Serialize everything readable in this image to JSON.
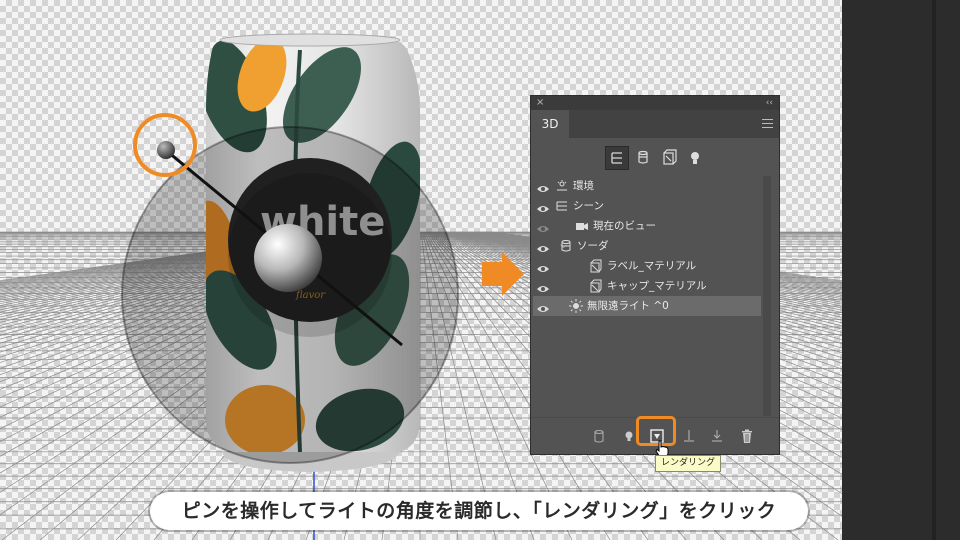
{
  "panel": {
    "tab_label": "3D",
    "close_glyph": "×",
    "collapse_glyph": "‹‹",
    "filter_icons": [
      "scene-filter-icon",
      "mesh-filter-icon",
      "material-filter-icon",
      "light-filter-icon"
    ],
    "layers": [
      {
        "label": "環境",
        "icon": "environment-icon",
        "visible": true,
        "selected": false
      },
      {
        "label": "シーン",
        "icon": "scene-icon",
        "visible": true,
        "selected": false
      },
      {
        "label": "現在のビュー",
        "icon": "camera-icon",
        "visible": false,
        "selected": false
      },
      {
        "label": "ソーダ",
        "icon": "mesh-icon",
        "visible": true,
        "selected": false,
        "expanded": true
      },
      {
        "label": "ラベル_マテリアル",
        "icon": "material-icon",
        "visible": true,
        "selected": false
      },
      {
        "label": "キャップ_マテリアル",
        "icon": "material-icon",
        "visible": true,
        "selected": false
      },
      {
        "label": "無限遠ライト ^0",
        "icon": "infinite-light-icon",
        "visible": true,
        "selected": true
      }
    ],
    "bottom_buttons": [
      "add-mesh-icon",
      "add-light-icon",
      "render-icon",
      "move-to-ground-icon",
      "drop-to-ground-icon",
      "delete-icon"
    ],
    "tooltip": "レンダリング"
  },
  "can": {
    "label_text": "white",
    "label_subtext": "flavor"
  },
  "caption": "ピンを操作してライトの角度を調節し、「レンダリング」をクリック",
  "colors": {
    "accent_orange": "#f08a24",
    "panel_bg": "#535353",
    "panel_dark": "#424242",
    "selected_row": "#6b6b6b",
    "tooltip_bg": "#fbfbc8"
  }
}
